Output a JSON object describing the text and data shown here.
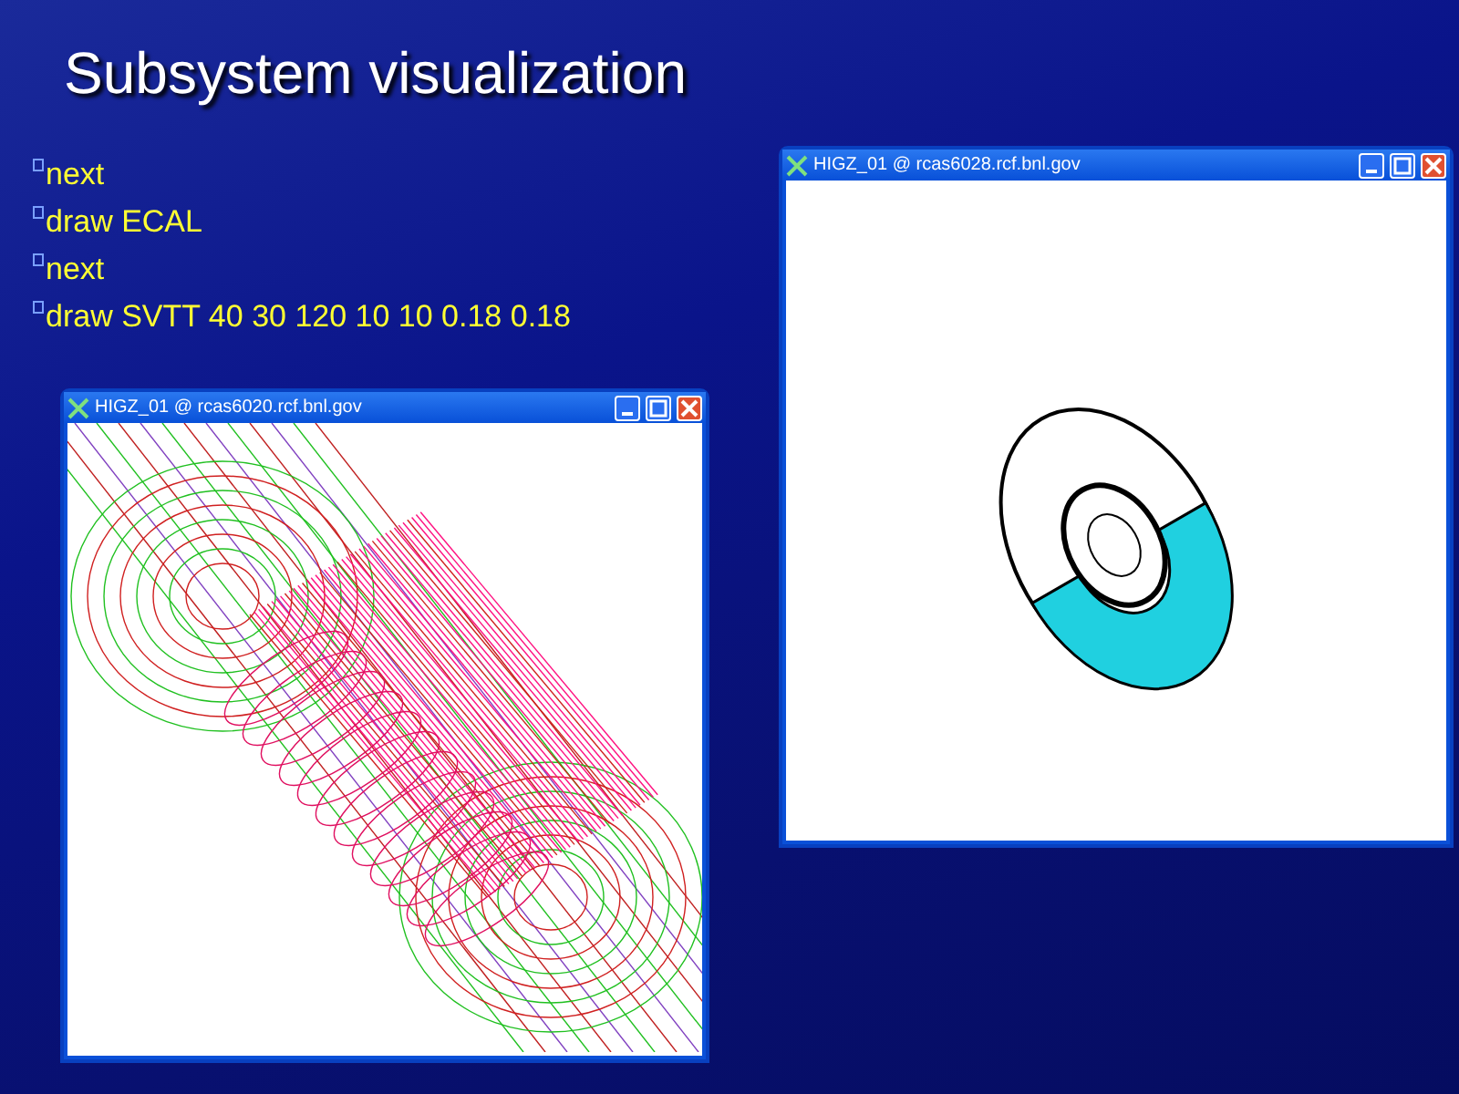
{
  "slide": {
    "title": "Subsystem visualization",
    "items": [
      {
        "text": "next"
      },
      {
        "text": "draw ECAL"
      },
      {
        "text": "next"
      },
      {
        "text": "draw SVTT 40 30 120 10 10 0.18 0.18"
      }
    ],
    "windows": [
      {
        "title": "HIGZ_01 @ rcas6020.rcf.bnl.gov",
        "kind": "svtt"
      },
      {
        "title": "HIGZ_01 @ rcas6028.rcf.bnl.gov",
        "kind": "ecal"
      }
    ]
  }
}
